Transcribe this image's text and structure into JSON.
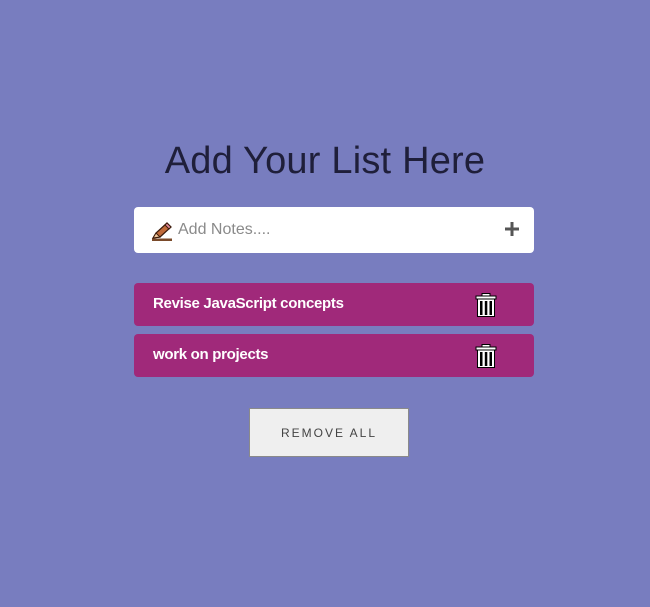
{
  "header": {
    "title": "Add Your List Here"
  },
  "input": {
    "placeholder": "Add Notes....",
    "value": "",
    "icon": "pencil-icon",
    "add_icon": "plus-icon"
  },
  "todos": [
    {
      "text": "Revise JavaScript concepts",
      "delete_icon": "trash-icon"
    },
    {
      "text": "work on projects",
      "delete_icon": "trash-icon"
    }
  ],
  "actions": {
    "remove_all_label": "REMOVE ALL"
  },
  "colors": {
    "background": "#787dbf",
    "item_background": "#a0297a",
    "input_background": "#ffffff",
    "button_background": "#efefef"
  }
}
